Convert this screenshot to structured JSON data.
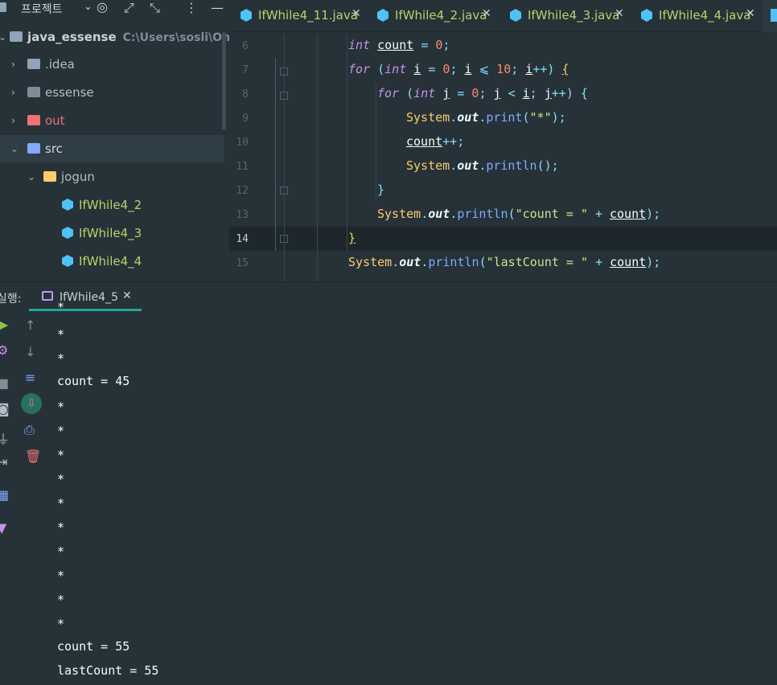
{
  "project_panel": {
    "title": "프로젝트",
    "header_icons": [
      "chevron-down-icon",
      "target-icon",
      "expand-icon",
      "collapse-icon",
      "more-icon",
      "minimize-icon"
    ],
    "root": {
      "name": "java_essense",
      "path": "C:\\Users\\sosli\\OneDr"
    },
    "items": [
      {
        "label": ".idea",
        "icon": "idea-folder-icon"
      },
      {
        "label": "essense",
        "icon": "folder-icon"
      },
      {
        "label": "out",
        "icon": "out-folder-icon"
      },
      {
        "label": "src",
        "icon": "src-folder-icon"
      },
      {
        "label": "jogun",
        "icon": "package-folder-icon"
      },
      {
        "label": "IfWhile4_2",
        "icon": "java-class-icon"
      },
      {
        "label": "IfWhile4_3",
        "icon": "java-class-icon"
      },
      {
        "label": "IfWhile4_4",
        "icon": "java-class-icon"
      }
    ]
  },
  "editor_tabs": [
    {
      "label": "IfWhile4_11.java",
      "close": "✕"
    },
    {
      "label": "IfWhile4_2.java",
      "close": "✕"
    },
    {
      "label": "IfWhile4_3.java",
      "close": "✕"
    },
    {
      "label": "IfWhile4_4.java",
      "close": "✕"
    }
  ],
  "editor": {
    "line_numbers": [
      "6",
      "7",
      "8",
      "9",
      "10",
      "11",
      "12",
      "13",
      "14",
      "15"
    ],
    "current_line": "14"
  },
  "run_panel": {
    "label": "실행:",
    "tab_label": "IfWhile4_5",
    "tab_close": "✕",
    "console_lines": [
      "*",
      "*",
      "*",
      "count = 45",
      "*",
      "*",
      "*",
      "*",
      "*",
      "*",
      "*",
      "*",
      "*",
      "*",
      "count = 55",
      "lastCount = 55"
    ]
  },
  "colors": {
    "background": "#263238",
    "accent": "#26a69a",
    "keyword": "#c792ea",
    "number": "#f78c6c",
    "string": "#c3e88d",
    "function": "#82aaff",
    "class": "#ffcb6b",
    "tab_text": "#b8d36a"
  }
}
